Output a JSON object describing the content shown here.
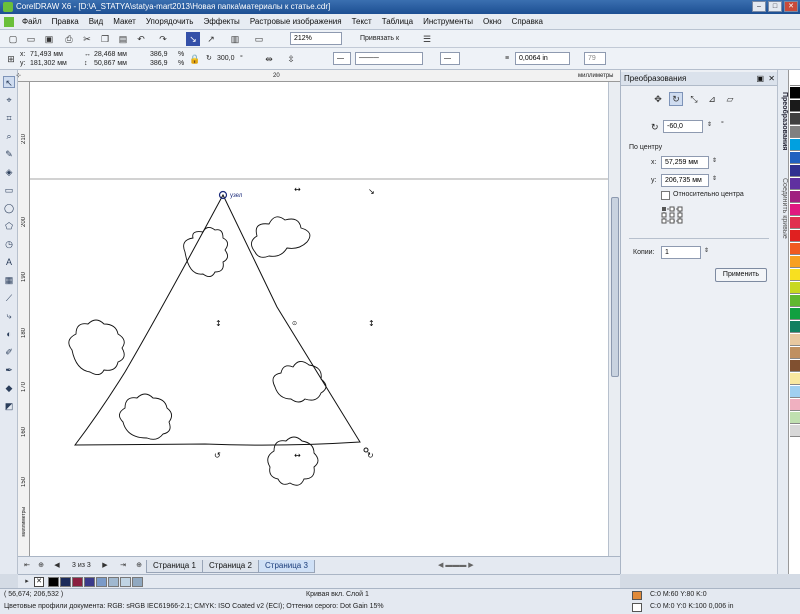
{
  "window": {
    "title": "CorelDRAW X6 - [D:\\A_STATYA\\statya-mart2013\\Новая папка\\материалы к статье.cdr]"
  },
  "menu": [
    "Файл",
    "Правка",
    "Вид",
    "Макет",
    "Упорядочить",
    "Эффекты",
    "Растровые изображения",
    "Текст",
    "Таблица",
    "Инструменты",
    "Окно",
    "Справка"
  ],
  "toolbar": {
    "zoom": "212%",
    "snap_label": "Привязать к"
  },
  "propbar": {
    "x_label": "x:",
    "x": "71,493 мм",
    "y_label": "y:",
    "y": "181,302 мм",
    "w": "28,468 мм",
    "h": "50,867 мм",
    "sx": "386,9",
    "sy": "386,9",
    "pct": "%",
    "angle": "300,0",
    "deg": "°",
    "outline": "0,0064 in",
    "num": "79"
  },
  "ruler": {
    "units": "миллиметры",
    "vunits": "миллиметры",
    "htick": "20",
    "vticks": [
      "210",
      "200",
      "190",
      "180",
      "170",
      "160",
      "150"
    ]
  },
  "canvas": {
    "node_label": "узел"
  },
  "pages": {
    "counter": "3 из 3",
    "tabs": [
      "Страница 1",
      "Страница 2",
      "Страница 3"
    ]
  },
  "docker": {
    "title": "Преобразования",
    "angle_value": "-60,0",
    "deg": "°",
    "center_label": "По центру",
    "cx_label": "x:",
    "cx": "57,259 мм",
    "cy_label": "y:",
    "cy": "206,735 мм",
    "relative_label": "Относительно центра",
    "copies_label": "Копии:",
    "copies": "1",
    "apply_label": "Применить"
  },
  "docker_tabs": [
    "Преобразования",
    "Соединить кривые"
  ],
  "palette_colors": [
    "#ffffff",
    "#000000",
    "#1a1a1a",
    "#404040",
    "#808080",
    "#00a0e0",
    "#2060c0",
    "#303090",
    "#6030a0",
    "#a02080",
    "#e01880",
    "#e03050",
    "#e02020",
    "#f05a20",
    "#f8a020",
    "#f8e020",
    "#c8d820",
    "#60b830",
    "#10a040",
    "#108060",
    "#e8c8a0",
    "#c09060",
    "#805030",
    "#f8e8a0",
    "#a0d0f0",
    "#f0b0c0",
    "#c0e0b0",
    "#d8d8d8"
  ],
  "bottom_swatches": [
    "#000000",
    "#1a2a5a",
    "#8a2040",
    "#3a3a8a",
    "#7a9ac8",
    "#a0b8d0",
    "#c0d4e4",
    "#90a8c0"
  ],
  "status": {
    "coords": "( 56,674; 206,532 )",
    "object": "Кривая вкл. Слой 1",
    "profiles": "Цветовые профили документа: RGB: sRGB IEC61966-2.1; CMYK: ISO Coated v2 (ECI); Оттенки серого: Dot Gain 15%",
    "fill": "C:0 M:60 Y:80 K:0",
    "fill_color": "#e08a3a",
    "outline": "C:0 M:0 Y:0 K:100  0,006 in"
  }
}
